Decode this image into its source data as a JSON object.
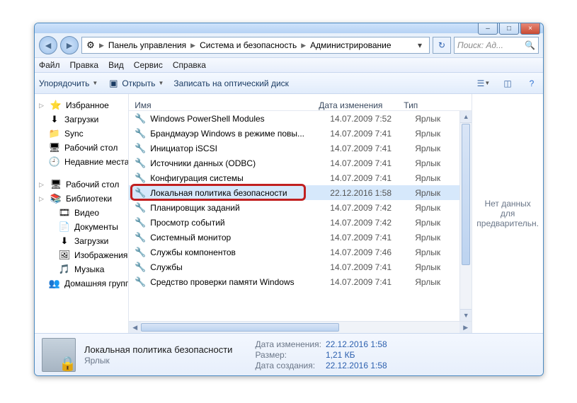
{
  "window_controls": {
    "min": "–",
    "max": "□",
    "close": "×"
  },
  "breadcrumb": [
    "Панель управления",
    "Система и безопасность",
    "Администрирование"
  ],
  "search": {
    "placeholder": "Поиск: Ад..."
  },
  "menu": [
    "Файл",
    "Правка",
    "Вид",
    "Сервис",
    "Справка"
  ],
  "toolbar": {
    "organize": "Упорядочить",
    "open": "Открыть",
    "burn": "Записать на оптический диск"
  },
  "nav": {
    "favorites": {
      "label": "Избранное",
      "items": [
        {
          "icon": "⬇",
          "label": "Загрузки"
        },
        {
          "icon": "📁",
          "label": "Sync"
        },
        {
          "icon": "🖥",
          "label": "Рабочий стол"
        },
        {
          "icon": "🕘",
          "label": "Недавние места"
        }
      ]
    },
    "desktop": {
      "label": "Рабочий стол",
      "items": [
        {
          "icon": "📚",
          "label": "Библиотеки",
          "expanded": true,
          "children": [
            {
              "icon": "🎞",
              "label": "Видео"
            },
            {
              "icon": "📄",
              "label": "Документы"
            },
            {
              "icon": "⬇",
              "label": "Загрузки"
            },
            {
              "icon": "🖼",
              "label": "Изображения"
            },
            {
              "icon": "🎵",
              "label": "Музыка"
            }
          ]
        },
        {
          "icon": "👥",
          "label": "Домашняя группа"
        }
      ]
    }
  },
  "columns": {
    "name": "Имя",
    "date": "Дата изменения",
    "type": "Тип"
  },
  "files": [
    {
      "name": "Windows PowerShell Modules",
      "date": "14.07.2009 7:52",
      "type": "Ярлык"
    },
    {
      "name": "Брандмауэр Windows в режиме повы...",
      "date": "14.07.2009 7:41",
      "type": "Ярлык"
    },
    {
      "name": "Инициатор iSCSI",
      "date": "14.07.2009 7:41",
      "type": "Ярлык"
    },
    {
      "name": "Источники данных (ODBC)",
      "date": "14.07.2009 7:41",
      "type": "Ярлык"
    },
    {
      "name": "Конфигурация системы",
      "date": "14.07.2009 7:41",
      "type": "Ярлык"
    },
    {
      "name": "Локальная политика безопасности",
      "date": "22.12.2016 1:58",
      "type": "Ярлык",
      "selected": true,
      "highlight": true
    },
    {
      "name": "Планировщик заданий",
      "date": "14.07.2009 7:42",
      "type": "Ярлык"
    },
    {
      "name": "Просмотр событий",
      "date": "14.07.2009 7:42",
      "type": "Ярлык"
    },
    {
      "name": "Системный монитор",
      "date": "14.07.2009 7:41",
      "type": "Ярлык"
    },
    {
      "name": "Службы компонентов",
      "date": "14.07.2009 7:46",
      "type": "Ярлык"
    },
    {
      "name": "Службы",
      "date": "14.07.2009 7:41",
      "type": "Ярлык"
    },
    {
      "name": "Средство проверки памяти Windows",
      "date": "14.07.2009 7:41",
      "type": "Ярлык"
    }
  ],
  "preview": {
    "text": "Нет данных для предварительн."
  },
  "details": {
    "title": "Локальная политика безопасности",
    "sub": "Ярлык",
    "meta": {
      "modified_label": "Дата изменения:",
      "modified": "22.12.2016 1:58",
      "size_label": "Размер:",
      "size": "1,21 КБ",
      "created_label": "Дата создания:",
      "created": "22.12.2016 1:58"
    }
  }
}
